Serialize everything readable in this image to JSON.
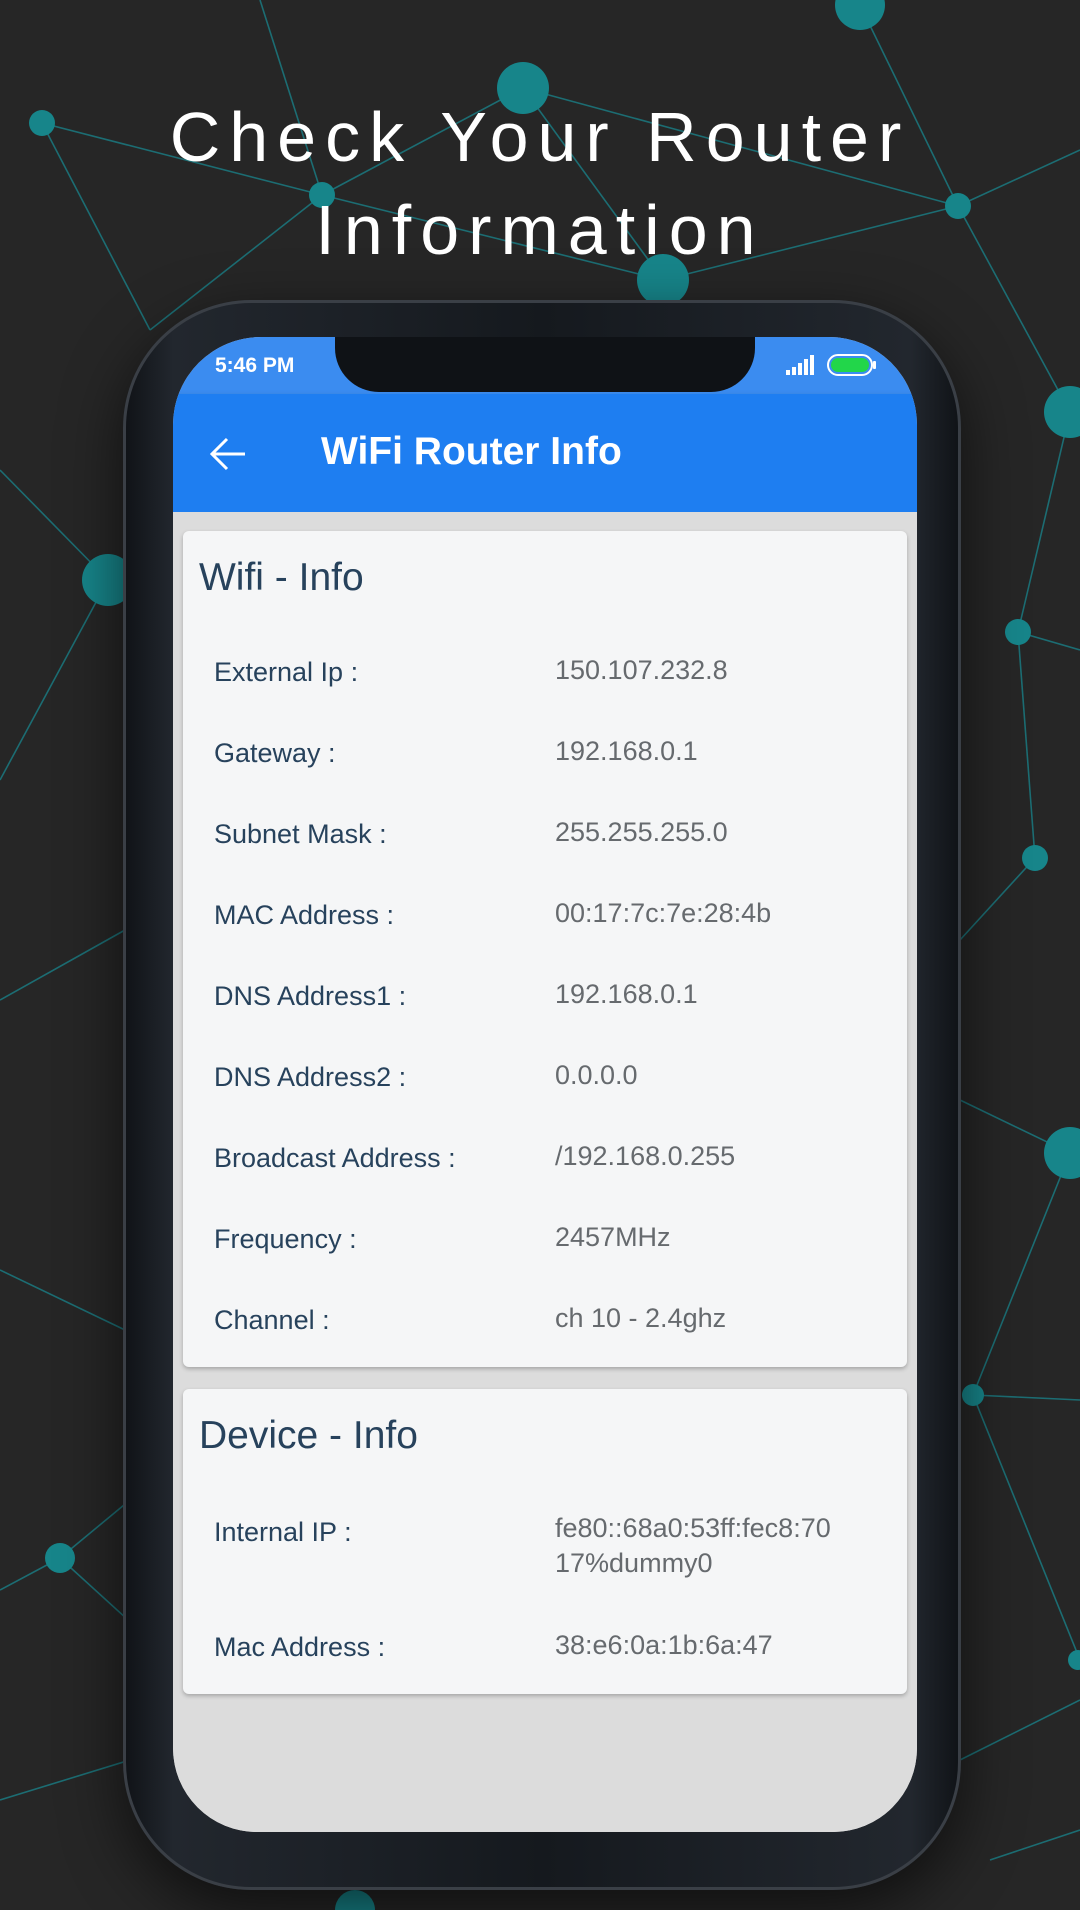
{
  "headline": {
    "line1": "Check Your Router",
    "line2": "Information"
  },
  "status_bar": {
    "time": "5:46 PM",
    "signal_icon": "signal-icon",
    "battery_icon": "battery-icon"
  },
  "app_bar": {
    "title": "WiFi Router Info",
    "back_icon": "back-arrow-icon"
  },
  "colors": {
    "app_bar": "#1e7ef1",
    "status_bar": "#3b8cf0",
    "label": "#27425c",
    "value": "#666a6e",
    "network_node": "#17858a"
  },
  "wifi_info": {
    "title": "Wifi - Info",
    "rows": [
      {
        "label": "External Ip :",
        "value": "150.107.232.8"
      },
      {
        "label": "Gateway :",
        "value": "192.168.0.1"
      },
      {
        "label": "Subnet Mask :",
        "value": "255.255.255.0"
      },
      {
        "label": "MAC Address :",
        "value": "00:17:7c:7e:28:4b"
      },
      {
        "label": "DNS Address1 :",
        "value": "192.168.0.1"
      },
      {
        "label": "DNS Address2 :",
        "value": "0.0.0.0"
      },
      {
        "label": "Broadcast Address :",
        "value": "/192.168.0.255"
      },
      {
        "label": "Frequency :",
        "value": "2457MHz"
      },
      {
        "label": "Channel :",
        "value": "ch 10 - 2.4ghz"
      }
    ]
  },
  "device_info": {
    "title": "Device - Info",
    "rows": [
      {
        "label": "Internal IP :",
        "value_line1": "fe80::68a0:53ff:fec8:70",
        "value_line2": "17%dummy0"
      },
      {
        "label": "Mac Address :",
        "value": "38:e6:0a:1b:6a:47"
      }
    ]
  }
}
